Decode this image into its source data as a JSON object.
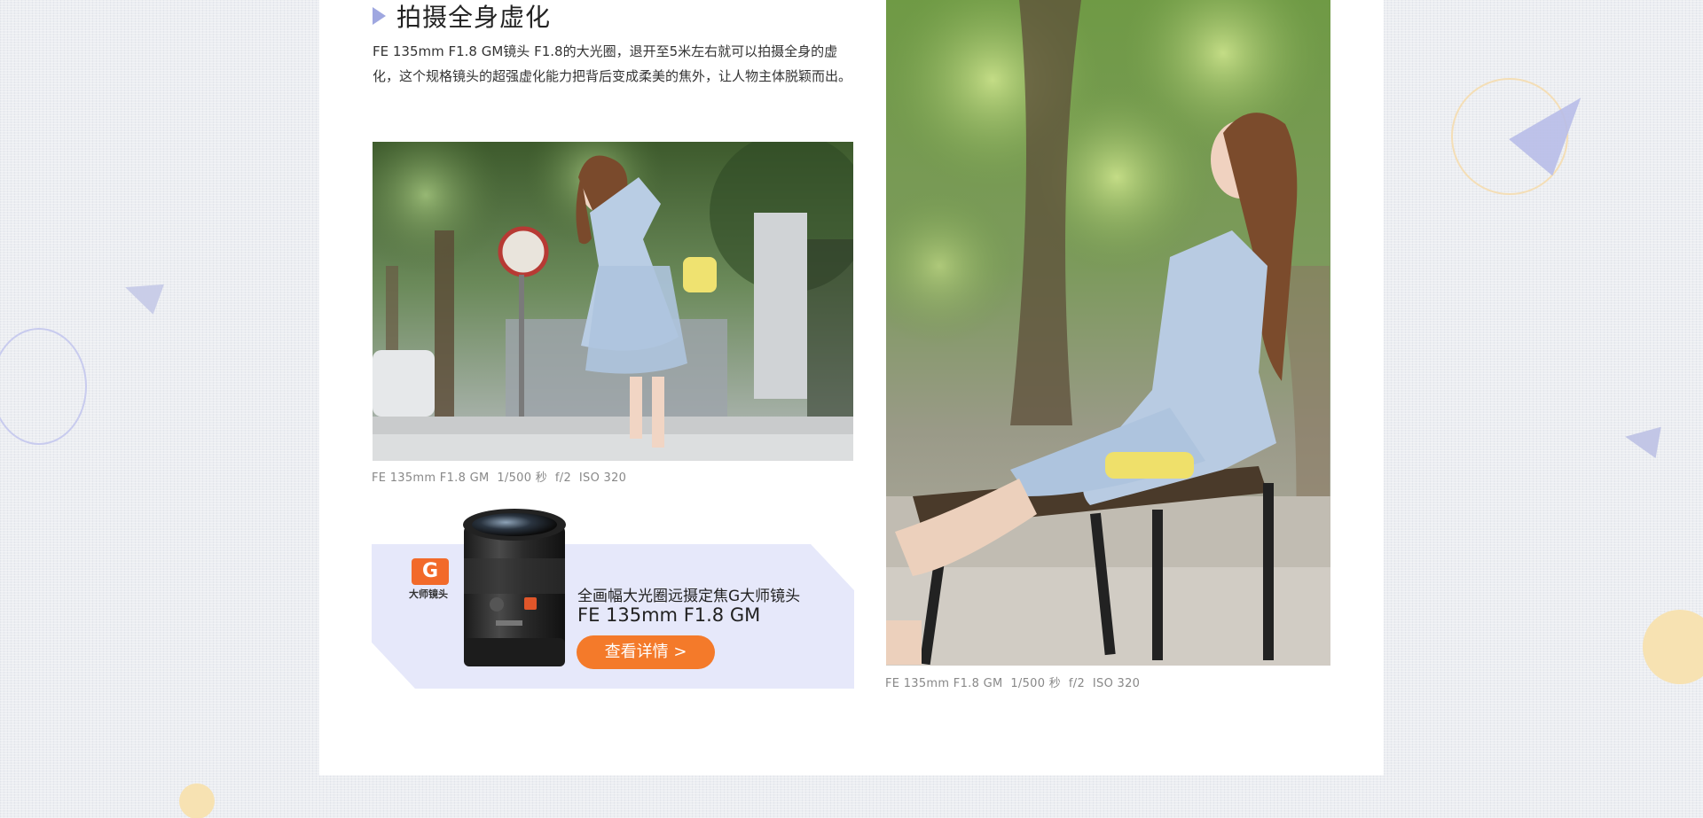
{
  "section": {
    "heading": "拍摄全身虚化",
    "description": "FE 135mm F1.8 GM镜头 F1.8的大光圈，退开至5米左右就可以拍摄全身的虚化，这个规格镜头的超强虚化能力把背后变成柔美的焦外，让人物主体脱颖而出。"
  },
  "photos": [
    {
      "caption": "FE 135mm F1.8 GM  1/500 秒  f/2  ISO 320"
    },
    {
      "caption": "FE 135mm F1.8 GM  1/500 秒  f/2  ISO 320"
    }
  ],
  "promo": {
    "badge_letter": "G",
    "badge_label": "大师镜头",
    "subtitle": "全画幅大光圈远摄定焦G大师镜头",
    "title": "FE 135mm F1.8 GM",
    "button_label": "查看详情 >"
  },
  "colors": {
    "accent_orange": "#f47a2a",
    "badge_orange": "#f26a2a",
    "heading_arrow": "#9fa7e0",
    "promo_bg": "#e6e8fa"
  }
}
